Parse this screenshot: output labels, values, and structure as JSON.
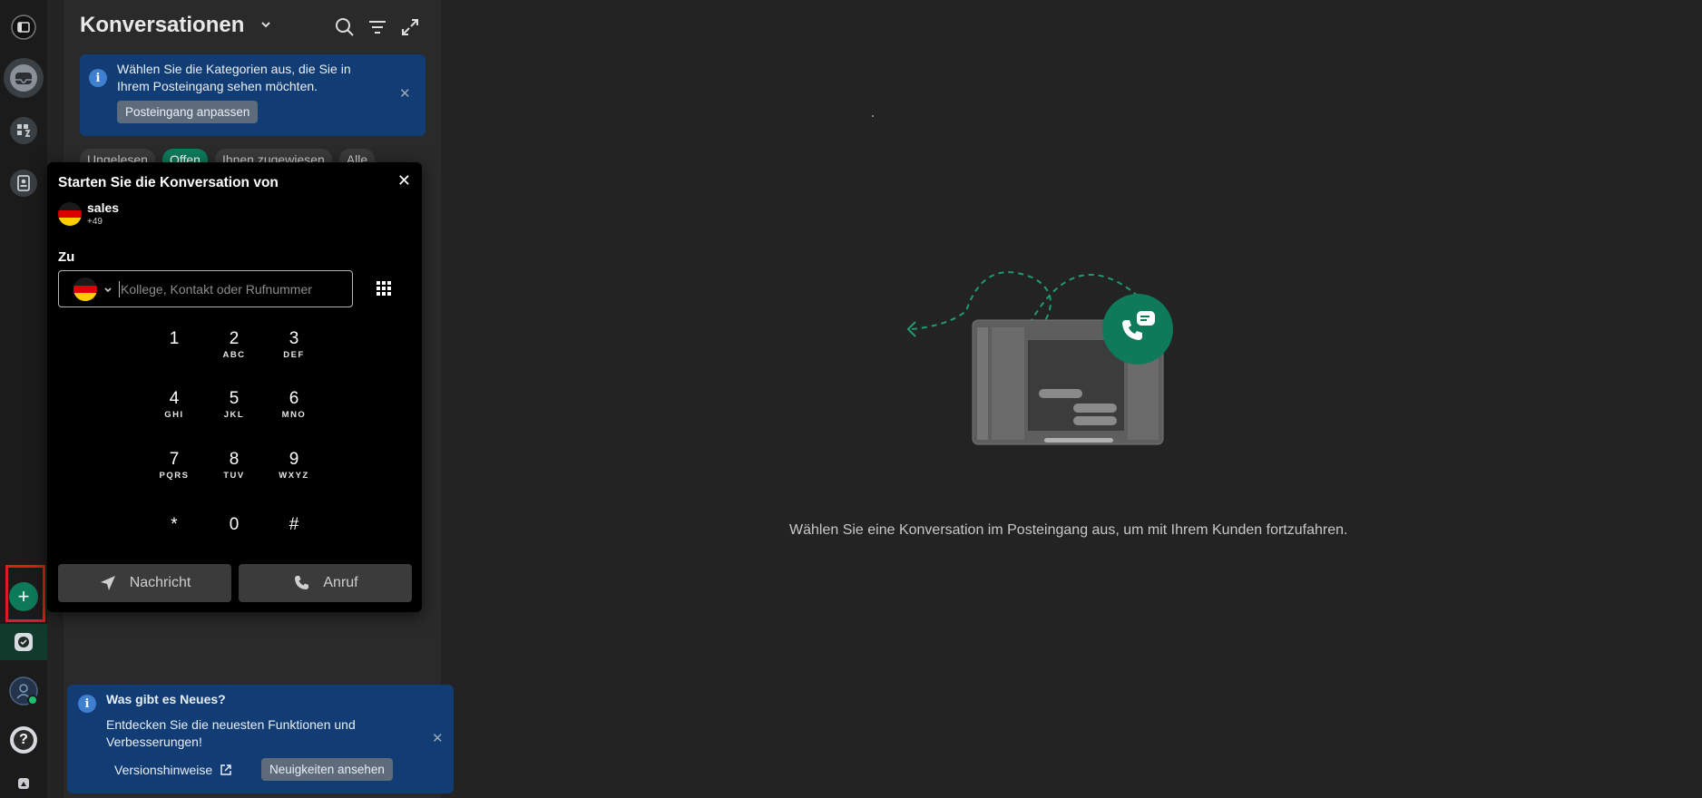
{
  "header": {
    "title": "Konversationen"
  },
  "banner_top": {
    "text_line1": "Wählen Sie die Kategorien aus, die Sie in",
    "text_line2": "Ihrem Posteingang sehen möchten.",
    "button": "Posteingang anpassen",
    "info_glyph": "i",
    "close_glyph": "✕"
  },
  "filters": [
    "Ungelesen",
    "Offen",
    "Ihnen zugewiesen",
    "Alle"
  ],
  "dialer": {
    "title": "Starten Sie die Konversation von",
    "close_glyph": "✕",
    "from": {
      "name": "sales",
      "number": "+49"
    },
    "to_label": "Zu",
    "input_placeholder": "Kollege, Kontakt oder Rufnummer",
    "keys": [
      {
        "digit": "1",
        "letters": ""
      },
      {
        "digit": "2",
        "letters": "ABC"
      },
      {
        "digit": "3",
        "letters": "DEF"
      },
      {
        "digit": "4",
        "letters": "GHI"
      },
      {
        "digit": "5",
        "letters": "JKL"
      },
      {
        "digit": "6",
        "letters": "MNO"
      },
      {
        "digit": "7",
        "letters": "PQRS"
      },
      {
        "digit": "8",
        "letters": "TUV"
      },
      {
        "digit": "9",
        "letters": "WXYZ"
      },
      {
        "digit": "*",
        "letters": ""
      },
      {
        "digit": "0",
        "letters": ""
      },
      {
        "digit": "#",
        "letters": ""
      }
    ],
    "message_button": "Nachricht",
    "call_button": "Anruf"
  },
  "banner_bottom": {
    "title": "Was gibt es Neues?",
    "text_line1": "Entdecken Sie die neuesten Funktionen und",
    "text_line2": "Verbesserungen!",
    "link": "Versionshinweise",
    "button": "Neuigkeiten ansehen",
    "info_glyph": "i",
    "close_glyph": "✕"
  },
  "main": {
    "empty_text": "Wählen Sie eine Konversation im Posteingang aus, um mit Ihrem Kunden fortzufahren."
  },
  "rail": {
    "add_glyph": "+",
    "help_glyph": "?"
  },
  "colors": {
    "accent_green": "#0e7a5a",
    "highlight_red": "#e01b1b",
    "info_blue": "#113d74",
    "flag_black": "#1a1a1a",
    "flag_red": "#dd0000",
    "flag_gold": "#ffce00"
  }
}
